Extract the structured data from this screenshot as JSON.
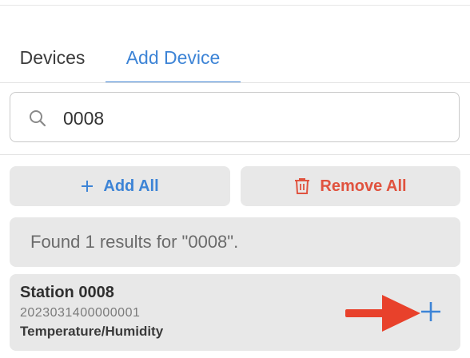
{
  "tabs": [
    {
      "label": "Devices",
      "active": false
    },
    {
      "label": "Add Device",
      "active": true
    }
  ],
  "accent_color": "#3d84d6",
  "danger_color": "#e0533f",
  "annotation_color": "#e8412b",
  "search": {
    "value": "0008",
    "icon": "search-icon"
  },
  "actions": {
    "add_all_label": "Add All",
    "add_all_icon": "plus-icon",
    "remove_all_label": "Remove All",
    "remove_all_icon": "trash-icon"
  },
  "result_message": "Found 1 results for \"0008\".",
  "devices": [
    {
      "name": "Station 0008",
      "serial": "2023031400000001",
      "type": "Temperature/Humidity",
      "action_icon": "plus-icon"
    }
  ],
  "annotation": {
    "icon": "arrow-right-icon"
  }
}
